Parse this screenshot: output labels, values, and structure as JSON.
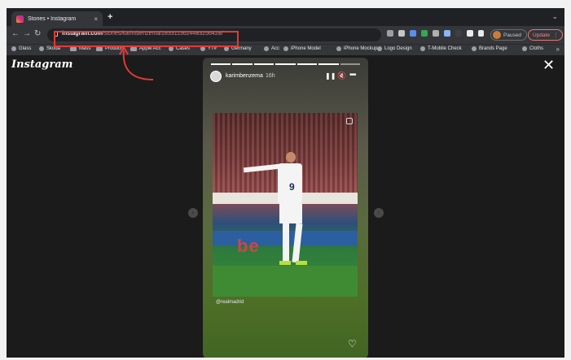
{
  "browser": {
    "tab_title": "Stories • Instagram",
    "tab_close": "×",
    "new_tab": "+",
    "tab_menu": "⌄",
    "url_host": "instagram.com",
    "url_path": "/stories/karimbenzema/2833113624483256428/",
    "paused_label": "Paused",
    "update_label": "Update",
    "update_menu": "⋮",
    "nav": {
      "back": "←",
      "forward": "→",
      "reload": "↻"
    },
    "bookmarks": [
      "Glass",
      "Skoda",
      "Mass",
      "Products",
      "Apple Acc",
      "Cases",
      "YT#",
      "Germany",
      "Acc",
      "iPhone Model",
      "iPhone Mockup",
      "Logo Design",
      "T-Mobile Check",
      "Brands Page",
      "Cloths"
    ],
    "bookmarks_more": "»"
  },
  "page": {
    "logo": "Instagram",
    "close": "✕",
    "prev": "‹",
    "next": "›"
  },
  "story": {
    "username": "karimbenzema",
    "time_ago": "16h",
    "pause_icon": "❚❚",
    "mute_icon": "🔇",
    "more_icon": "•••",
    "mention": "@realmadrid",
    "heart_icon": "♡",
    "jersey_number": "9",
    "ad_text": "be",
    "segments_total": 7,
    "segments_done": 6
  },
  "colors": {
    "annotation": "#e53935",
    "accent_update": "#f28b82"
  }
}
